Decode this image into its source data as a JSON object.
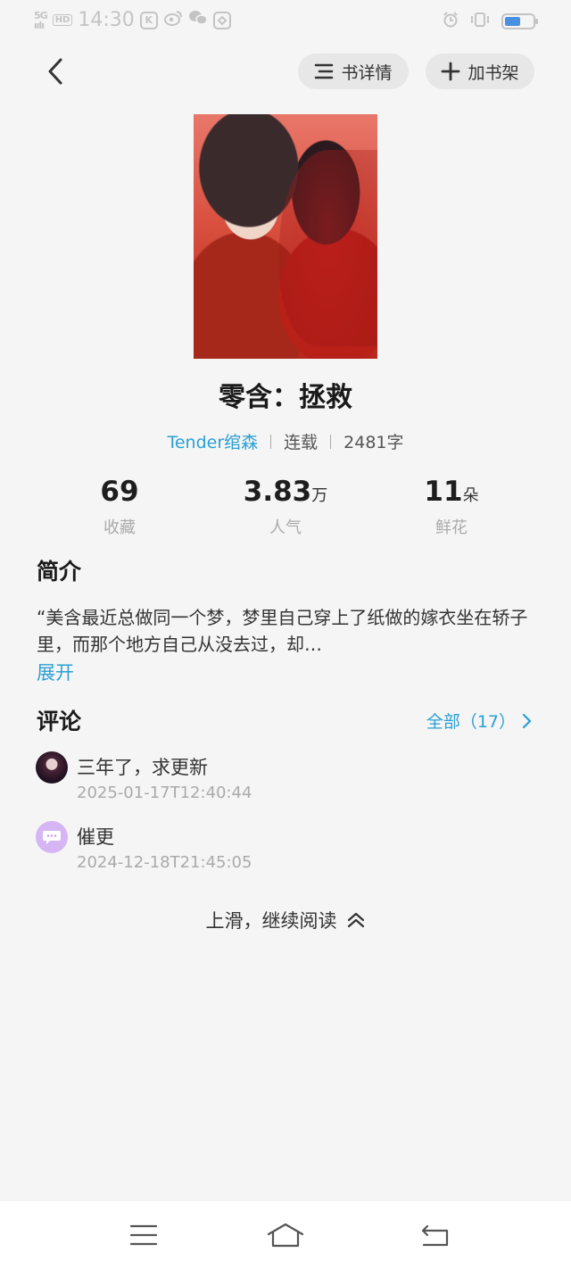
{
  "status_bar": {
    "signal": "5G\nııll",
    "hd": "HD",
    "time": "14:30",
    "app_badge": "K",
    "weibo": "ఠ",
    "wechat": "✱",
    "app_badge2": "◌",
    "alarm": "⏰",
    "vibrate": "▯",
    "battery_level": 0.55
  },
  "header": {
    "details_label": "书详情",
    "shelf_label": "加书架"
  },
  "book": {
    "title": "零含：拯救",
    "author": "Tender绾森",
    "status": "连载",
    "word_count": "2481字"
  },
  "stats": [
    {
      "value": "69",
      "unit": "",
      "label": "收藏"
    },
    {
      "value": "3.83",
      "unit": "万",
      "label": "人气"
    },
    {
      "value": "11",
      "unit": "朵",
      "label": "鲜花"
    }
  ],
  "intro": {
    "title": "简介",
    "text": "“美含最近总做同一个梦，梦里自己穿上了纸做的嫁衣坐在轿子里，而那个地方自己从没去过，却…",
    "expand_label": "展开"
  },
  "comments": {
    "title": "评论",
    "all_label": "全部（17）",
    "items": [
      {
        "text": "三年了，求更新",
        "time": "2025-01-17T12:40:44"
      },
      {
        "text": "催更",
        "time": "2024-12-18T21:45:05"
      }
    ]
  },
  "continue_label": "上滑，继续阅读",
  "colors": {
    "accent": "#2aa0d4",
    "background": "#f5f5f5"
  }
}
